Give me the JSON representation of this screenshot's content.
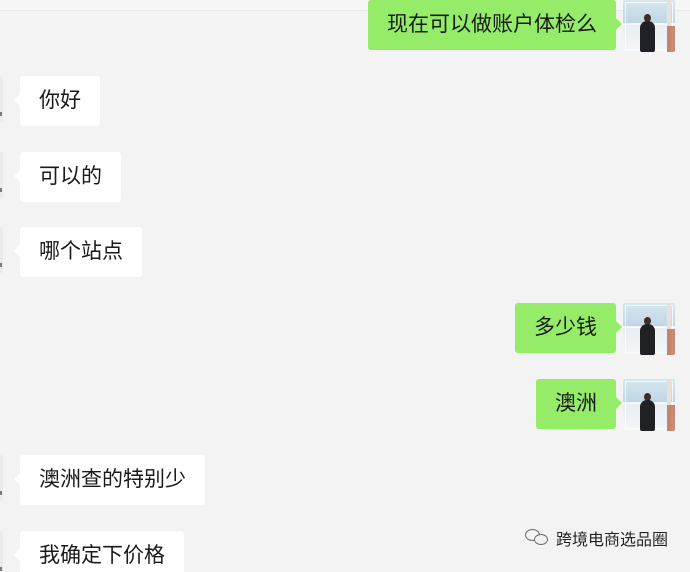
{
  "messages": [
    {
      "direction": "out",
      "text": "现在可以做账户体检么"
    },
    {
      "direction": "in",
      "text": "你好"
    },
    {
      "direction": "in",
      "text": "可以的"
    },
    {
      "direction": "in",
      "text": "哪个站点"
    },
    {
      "direction": "out",
      "text": "多少钱"
    },
    {
      "direction": "out",
      "text": "澳洲"
    },
    {
      "direction": "in",
      "text": "澳洲查的特别少"
    },
    {
      "direction": "in",
      "text": "我确定下价格"
    }
  ],
  "watermark": {
    "text": "跨境电商选品圈",
    "icon": "wechat-icon"
  },
  "colors": {
    "background": "#f3f3f3",
    "incoming_bubble": "#ffffff",
    "outgoing_bubble": "#95ec69",
    "text": "#1a1a1a"
  }
}
